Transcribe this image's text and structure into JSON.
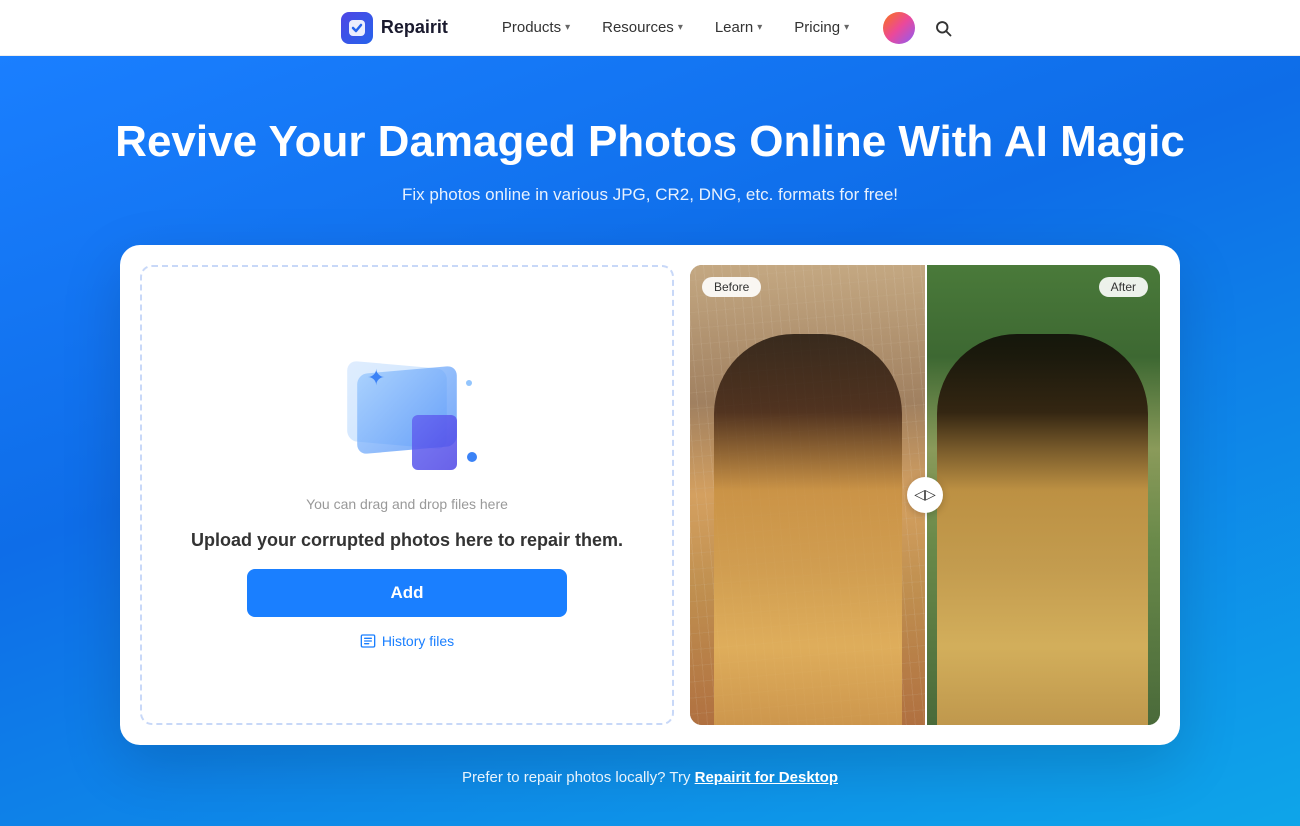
{
  "brand": {
    "name": "Repairit"
  },
  "nav": {
    "items": [
      {
        "label": "Products",
        "hasDropdown": true
      },
      {
        "label": "Resources",
        "hasDropdown": true
      },
      {
        "label": "Learn",
        "hasDropdown": true
      },
      {
        "label": "Pricing",
        "hasDropdown": true
      }
    ]
  },
  "hero": {
    "title": "Revive Your Damaged Photos Online With AI Magic",
    "subtitle": "Fix photos online in various JPG, CR2, DNG, etc. formats for free!"
  },
  "upload": {
    "drag_text": "You can drag and drop files here",
    "main_text": "Upload your corrupted photos here to repair them.",
    "add_button": "Add",
    "history_text": "History files"
  },
  "preview": {
    "before_label": "Before",
    "after_label": "After"
  },
  "footer_text": {
    "prefix": "Prefer to repair photos locally? Try ",
    "link_text": "Repairit for Desktop"
  }
}
